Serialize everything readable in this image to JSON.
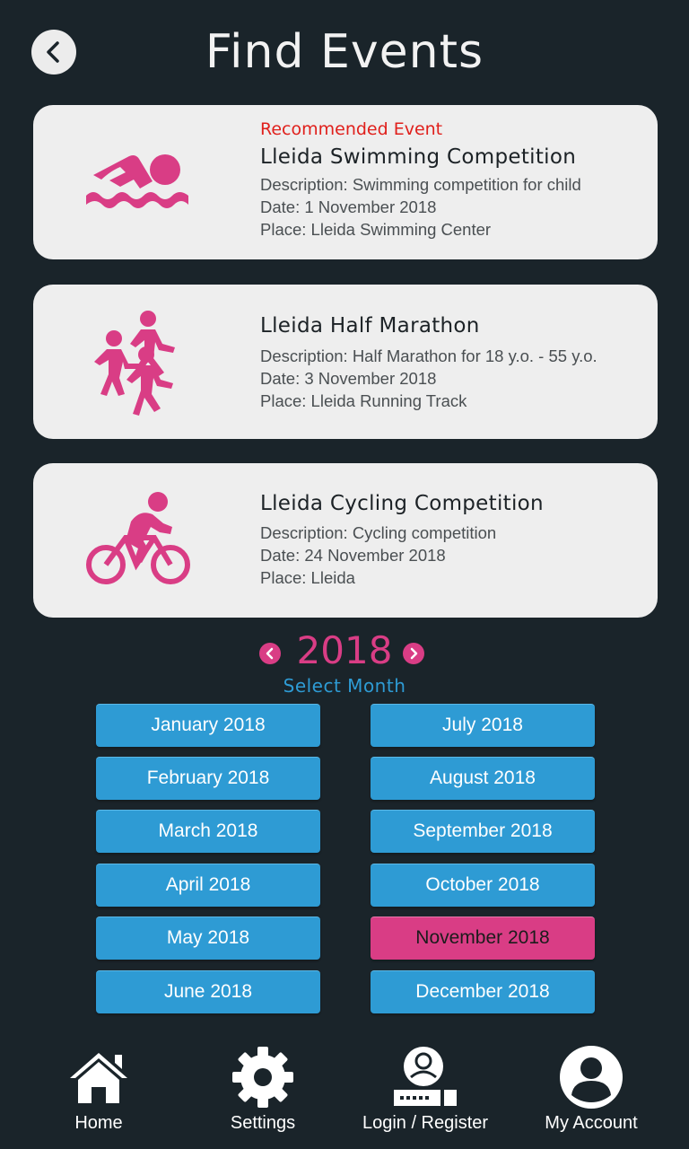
{
  "header": {
    "title": "Find Events"
  },
  "events": [
    {
      "badge": "Recommended Event",
      "name": "Lleida Swimming Competition",
      "description": "Description: Swimming competition for child",
      "date": "Date: 1 November 2018",
      "place": "Place: Lleida Swimming Center",
      "icon": "swimming-icon"
    },
    {
      "name": "Lleida Half Marathon",
      "description": "Description: Half Marathon for 18 y.o. - 55 y.o.",
      "date": "Date: 3 November 2018",
      "place": "Place: Lleida Running Track",
      "icon": "running-icon"
    },
    {
      "name": "Lleida Cycling Competition",
      "description": "Description: Cycling competition",
      "date": "Date: 24 November 2018",
      "place": "Place: Lleida",
      "icon": "cycling-icon"
    }
  ],
  "calendar": {
    "year": "2018",
    "select_label": "Select Month",
    "selected_month": "November 2018",
    "months": [
      "January 2018",
      "February 2018",
      "March 2018",
      "April 2018",
      "May 2018",
      "June 2018",
      "July 2018",
      "August 2018",
      "September 2018",
      "October 2018",
      "November 2018",
      "December 2018"
    ]
  },
  "nav": [
    {
      "label": "Home",
      "icon": "home-icon"
    },
    {
      "label": "Settings",
      "icon": "gear-icon"
    },
    {
      "label": "Login / Register",
      "icon": "login-icon"
    },
    {
      "label": "My Account",
      "icon": "account-icon"
    }
  ],
  "colors": {
    "background": "#1a242a",
    "accent_pink": "#d93d85",
    "accent_blue": "#2e9bd4",
    "recommended_red": "#e0201c",
    "card_bg": "#eeeeee"
  }
}
